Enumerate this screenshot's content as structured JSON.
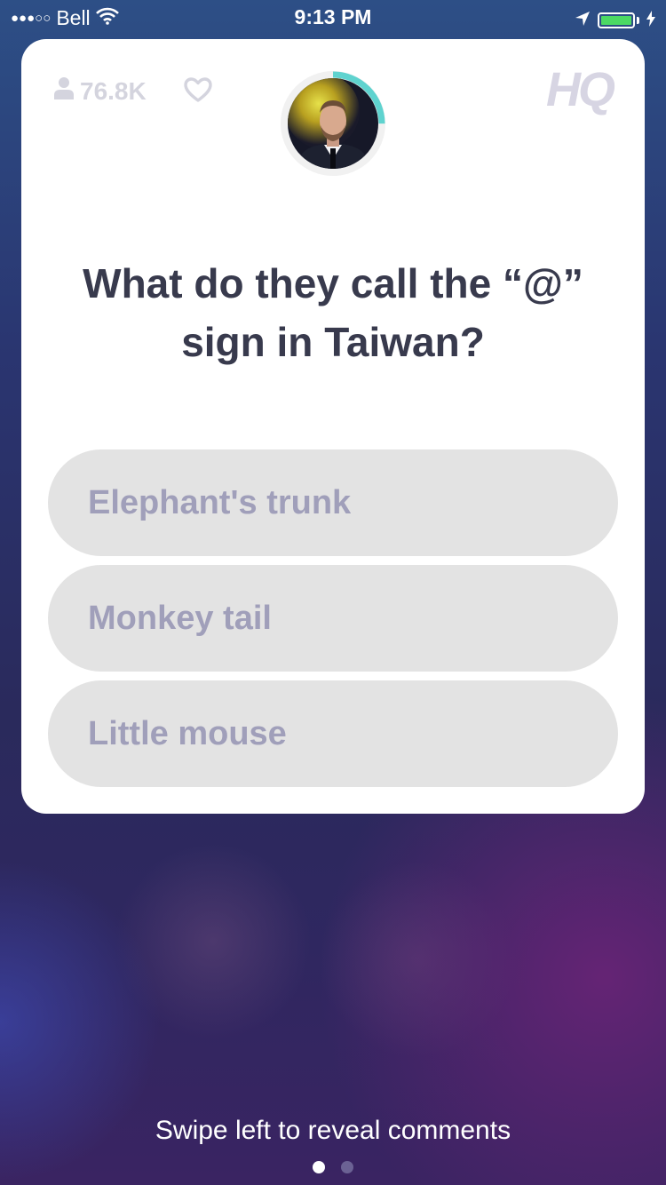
{
  "status_bar": {
    "signal_dots": "●●●○○",
    "carrier": "Bell",
    "time": "9:13 PM",
    "battery_level": 1.0
  },
  "card": {
    "viewer_count": "76.8K",
    "logo": "HQ",
    "timer_progress": 0.25,
    "question": "What do they call the “@” sign in Taiwan?",
    "answers": [
      {
        "label": "Elephant's trunk"
      },
      {
        "label": "Monkey tail"
      },
      {
        "label": "Little mouse"
      }
    ]
  },
  "footer": {
    "hint": "Swipe left to reveal comments",
    "pages": {
      "current": 1,
      "total": 2
    }
  },
  "colors": {
    "timer_ring": "#5fd3cf",
    "answer_bg": "#e3e3e3",
    "answer_text": "#a09fba",
    "question_text": "#383a4d",
    "battery_green": "#4cd964"
  },
  "icons": [
    "wifi-icon",
    "location-arrow-icon",
    "battery-icon",
    "charging-bolt-icon",
    "person-icon",
    "heart-icon",
    "host-avatar"
  ]
}
